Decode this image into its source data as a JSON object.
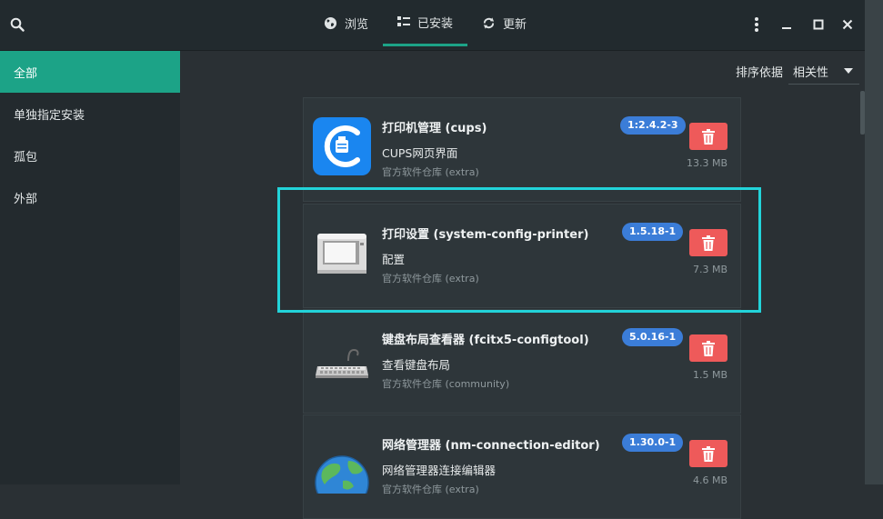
{
  "header": {
    "tabs": [
      {
        "label": "浏览",
        "icon": "globe-icon"
      },
      {
        "label": "已安装",
        "icon": "list-icon"
      },
      {
        "label": "更新",
        "icon": "refresh-icon"
      }
    ],
    "active_tab": "已安装"
  },
  "sidebar": {
    "items": [
      {
        "label": "全部"
      },
      {
        "label": "单独指定安装"
      },
      {
        "label": "孤包"
      },
      {
        "label": "外部"
      }
    ],
    "active": "全部"
  },
  "sort": {
    "label": "排序依据",
    "value": "相关性"
  },
  "packages": [
    {
      "name": "打印机管理 (cups)",
      "description": "CUPS网页界面",
      "repo": "官方软件仓库 (extra)",
      "version": "1:2.4.2-3",
      "size": "13.3 MB",
      "icon": "cups-icon"
    },
    {
      "name": "打印设置 (system-config-printer)",
      "description": "配置",
      "repo": "官方软件仓库 (extra)",
      "version": "1.5.18-1",
      "size": "7.3 MB",
      "icon": "printer-icon"
    },
    {
      "name": "键盘布局查看器 (fcitx5-configtool)",
      "description": "查看键盘布局",
      "repo": "官方软件仓库 (community)",
      "version": "5.0.16-1",
      "size": "1.5 MB",
      "icon": "keyboard-icon"
    },
    {
      "name": "网络管理器 (nm-connection-editor)",
      "description": "网络管理器连接编辑器",
      "repo": "官方软件仓库 (extra)",
      "version": "1.30.0-1",
      "size": "4.6 MB",
      "icon": "globe-network-icon"
    }
  ],
  "colors": {
    "accent": "#1ca387",
    "version_badge": "#3b7dd8",
    "remove_button": "#ee5a5a",
    "highlight": "#22d3d9"
  }
}
